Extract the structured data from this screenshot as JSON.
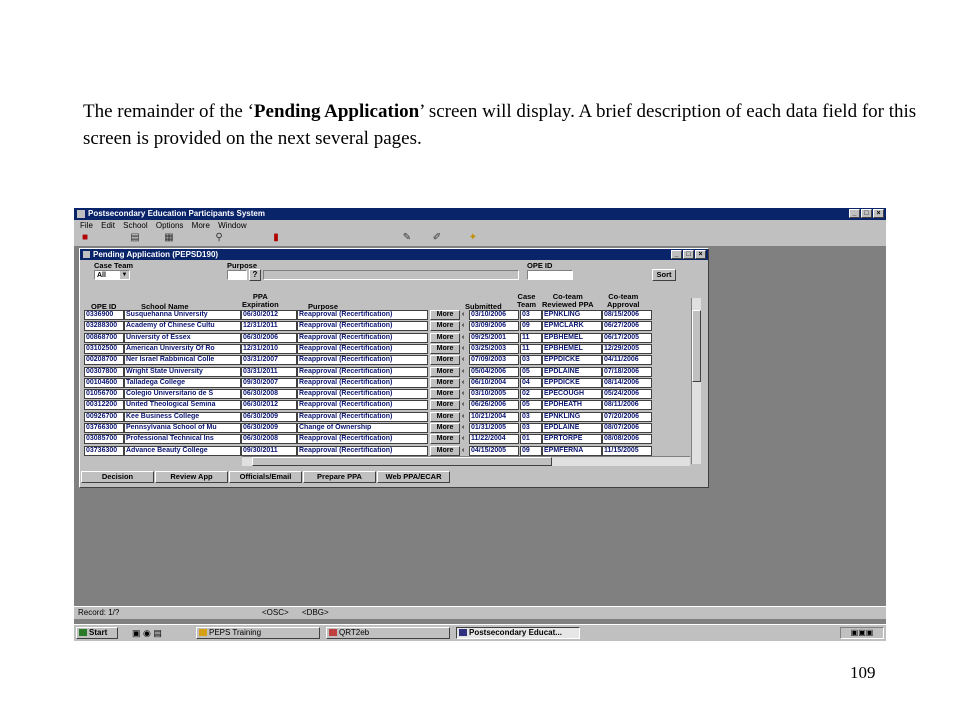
{
  "caption": {
    "p1": "The remainder of the ‘",
    "bold": "Pending Application",
    "p2": "’ screen will display.  A brief description of each data field for this screen is provided on the next several pages."
  },
  "page_number": "109",
  "app": {
    "title": "Postsecondary Education Participants System",
    "menu": [
      "File",
      "Edit",
      "School",
      "Options",
      "More",
      "Window"
    ]
  },
  "inner": {
    "title": "Pending Application (PEPSD190)",
    "labels": {
      "case_team": "Case Team",
      "purpose": "Purpose",
      "ope_id": "OPE ID"
    },
    "case_team_value": "All",
    "sort_label": "Sort",
    "headers": {
      "ope_id": "OPE ID",
      "school_name": "School Name",
      "ppa_expiration": "PPA\nExpiration",
      "purpose": "Purpose",
      "submitted": "Submitted",
      "case_team": "Case\nTeam",
      "reviewed_ppa": "Co-team\nReviewed PPA",
      "approval": "Co-team\nApproval"
    },
    "rows": [
      {
        "ope": "0336900",
        "school": "Susquehanna University",
        "exp": "06/30/2012",
        "purpose": "Reapproval (Recertification)",
        "more": "More",
        "submitted": "03/10/2006",
        "team": "03",
        "reviewer": "EPNKLING",
        "approval": "08/15/2006"
      },
      {
        "ope": "03288300",
        "school": "Academy of Chinese Cultu",
        "exp": "12/31/2011",
        "purpose": "Reapproval (Recertification)",
        "more": "More",
        "submitted": "03/09/2006",
        "team": "09",
        "reviewer": "EPMCLARK",
        "approval": "06/27/2006"
      },
      {
        "ope": "00868700",
        "school": "University of Essex",
        "exp": "06/30/2006",
        "purpose": "Reapproval (Recertification)",
        "more": "More",
        "submitted": "09/25/2001",
        "team": "11",
        "reviewer": "EPBHEMEL",
        "approval": "06/17/2005"
      },
      {
        "ope": "03102500",
        "school": "American University Of Ro",
        "exp": "12/31/2010",
        "purpose": "Reapproval (Recertification)",
        "more": "More",
        "submitted": "03/25/2003",
        "team": "11",
        "reviewer": "EPBHEMEL",
        "approval": "12/29/2005"
      },
      {
        "ope": "00208700",
        "school": "Ner Israel Rabbinical Colle",
        "exp": "03/31/2007",
        "purpose": "Reapproval (Recertification)",
        "more": "More",
        "submitted": "07/09/2003",
        "team": "03",
        "reviewer": "EPPDICKE",
        "approval": "04/11/2006"
      },
      {
        "ope": "00307800",
        "school": "Wright State University",
        "exp": "03/31/2011",
        "purpose": "Reapproval (Recertification)",
        "more": "More",
        "submitted": "05/04/2006",
        "team": "05",
        "reviewer": "EPDLAINE",
        "approval": "07/18/2006"
      },
      {
        "ope": "00104600",
        "school": "Talladega College",
        "exp": "09/30/2007",
        "purpose": "Reapproval (Recertification)",
        "more": "More",
        "submitted": "06/10/2004",
        "team": "04",
        "reviewer": "EPPDICKE",
        "approval": "08/14/2006"
      },
      {
        "ope": "01056700",
        "school": "Colegio Universitario de S",
        "exp": "06/30/2008",
        "purpose": "Reapproval (Recertification)",
        "more": "More",
        "submitted": "03/10/2005",
        "team": "02",
        "reviewer": "EPECOUGH",
        "approval": "05/24/2006"
      },
      {
        "ope": "00312200",
        "school": "United Theological Semina",
        "exp": "06/30/2012",
        "purpose": "Reapproval (Recertification)",
        "more": "More",
        "submitted": "06/26/2006",
        "team": "05",
        "reviewer": "EPDHEATH",
        "approval": "08/11/2006"
      },
      {
        "ope": "00926700",
        "school": "Kee Business College",
        "exp": "06/30/2009",
        "purpose": "Reapproval (Recertification)",
        "more": "More",
        "submitted": "10/21/2004",
        "team": "03",
        "reviewer": "EPNKLING",
        "approval": "07/20/2006"
      },
      {
        "ope": "03766300",
        "school": "Pennsylvania School of Mu",
        "exp": "06/30/2009",
        "purpose": "Change of Ownership",
        "more": "More",
        "submitted": "01/31/2005",
        "team": "03",
        "reviewer": "EPDLAINE",
        "approval": "08/07/2006"
      },
      {
        "ope": "03085700",
        "school": "Professional Technical Ins",
        "exp": "06/30/2008",
        "purpose": "Reapproval (Recertification)",
        "more": "More",
        "submitted": "11/22/2004",
        "team": "01",
        "reviewer": "EPRTORPE",
        "approval": "08/08/2006"
      },
      {
        "ope": "03736300",
        "school": "Advance Beauty College",
        "exp": "09/30/2011",
        "purpose": "Reapproval (Recertification)",
        "more": "More",
        "submitted": "04/15/2005",
        "team": "09",
        "reviewer": "EPMFERNA",
        "approval": "11/15/2005"
      }
    ],
    "buttons": [
      "Decision",
      "Review App",
      "Officials/Email",
      "Prepare PPA",
      "Web PPA/ECAR"
    ]
  },
  "statusbar": {
    "record": "Record: 1/?",
    "osc": "<OSC>",
    "dbg": "<DBG>"
  },
  "taskbar": {
    "start": "Start",
    "tasks": [
      "PEPS Training",
      "QRT2eb",
      "Postsecondary Educat..."
    ]
  }
}
